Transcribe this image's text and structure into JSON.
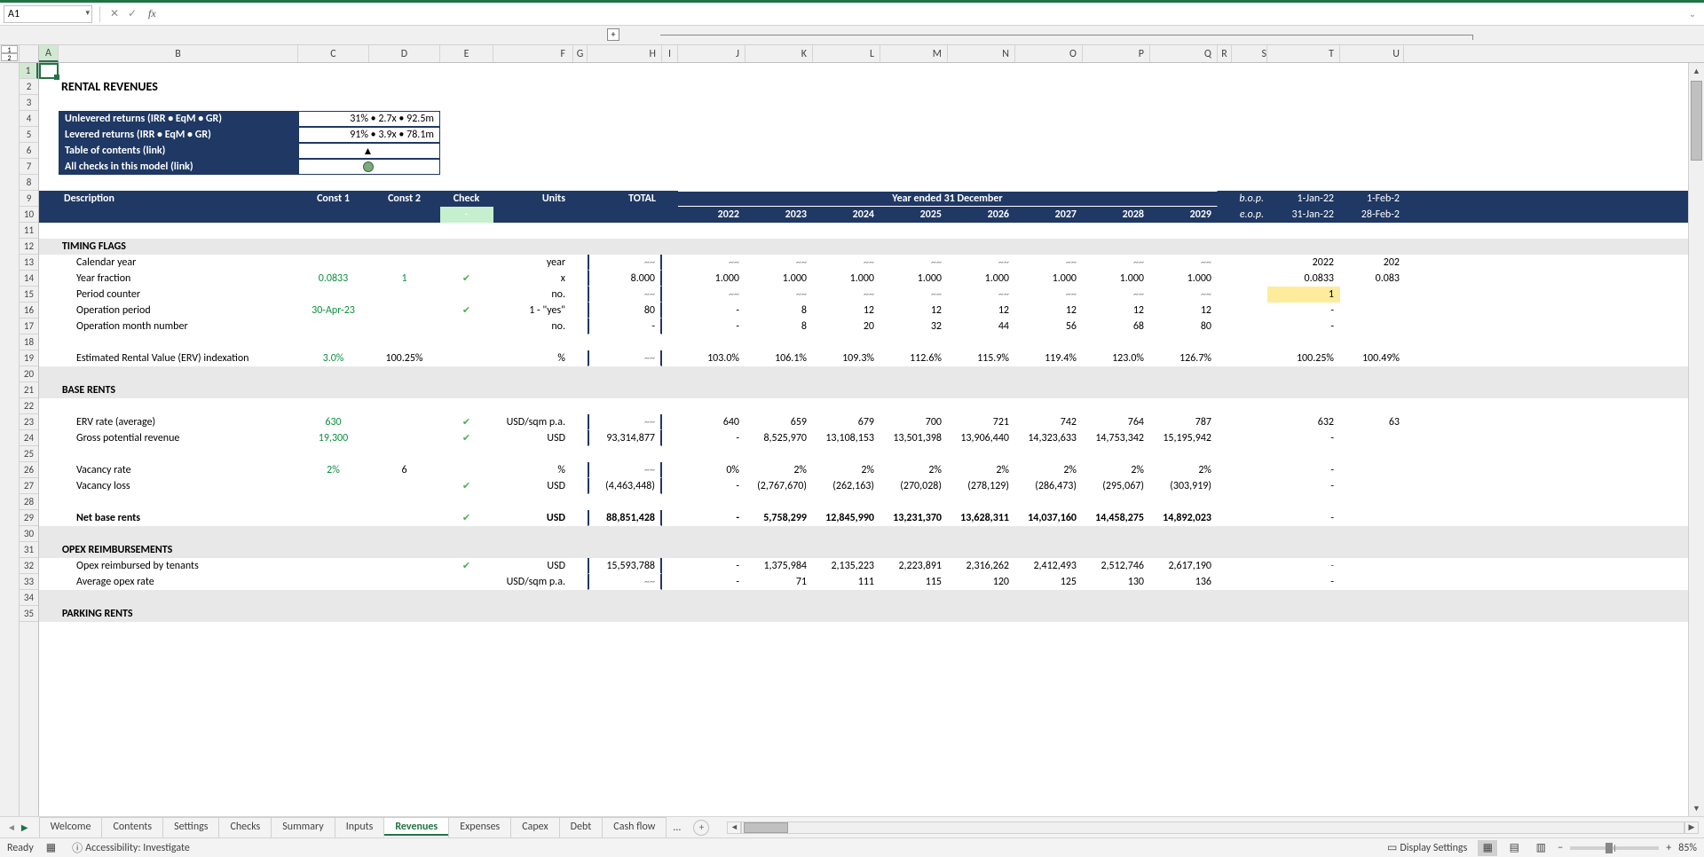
{
  "name_box": "A1",
  "formula_value": "",
  "sheet_title": "RENTAL REVENUES",
  "returns": {
    "unlevered_label": "Unlevered returns (IRR • EqM • GR)",
    "unlevered_value": "31% • 2.7x • 92.5m",
    "levered_label": "Levered returns (IRR • EqM • GR)",
    "levered_value": "91% • 3.9x • 78.1m",
    "toc_label": "Table of contents (link)",
    "checks_label": "All checks in this model (link)"
  },
  "header": {
    "desc": "Description",
    "c1": "Const 1",
    "c2": "Const 2",
    "check": "Check",
    "units": "Units",
    "total": "TOTAL",
    "year_group": "Year ended 31 December",
    "check_val": "-",
    "bop": "b.o.p.",
    "eop": "e.o.p.",
    "bop_t": "1-Jan-22",
    "eop_t": "31-Jan-22",
    "bop_u": "1-Feb-2",
    "eop_u": "28-Feb-2"
  },
  "years": [
    "2022",
    "2023",
    "2024",
    "2025",
    "2026",
    "2027",
    "2028",
    "2029"
  ],
  "sections": {
    "timing": "TIMING FLAGS",
    "base": "BASE RENTS",
    "opex": "OPEX REIMBURSEMENTS",
    "parking": "PARKING RENTS"
  },
  "rows": {
    "cal_year": {
      "desc": "Calendar year",
      "units": "year",
      "total": "~~",
      "y": [
        "~~",
        "~~",
        "~~",
        "~~",
        "~~",
        "~~",
        "~~",
        "~~"
      ],
      "t": "2022",
      "u": "202"
    },
    "year_frac": {
      "desc": "Year fraction",
      "c1": "0.0833",
      "c2": "1",
      "chk": true,
      "units": "x",
      "total": "8.000",
      "y": [
        "1.000",
        "1.000",
        "1.000",
        "1.000",
        "1.000",
        "1.000",
        "1.000",
        "1.000"
      ],
      "t": "0.0833",
      "u": "0.083"
    },
    "period_cnt": {
      "desc": "Period counter",
      "units": "no.",
      "total": "~~",
      "y": [
        "~~",
        "~~",
        "~~",
        "~~",
        "~~",
        "~~",
        "~~",
        "~~"
      ],
      "t": "1",
      "u": "",
      "t_hl": true
    },
    "op_period": {
      "desc": "Operation period",
      "c1": "30-Apr-23",
      "chk": true,
      "units": "1 - \"yes\"",
      "total": "80",
      "y": [
        "-",
        "8",
        "12",
        "12",
        "12",
        "12",
        "12",
        "12"
      ],
      "t": "-",
      "u": ""
    },
    "op_month": {
      "desc": "Operation month number",
      "units": "no.",
      "total": "-",
      "y": [
        "-",
        "8",
        "20",
        "32",
        "44",
        "56",
        "68",
        "80"
      ],
      "t": "-",
      "u": ""
    },
    "erv_idx": {
      "desc": "Estimated Rental Value (ERV) indexation",
      "c1": "3.0%",
      "c2": "100.25%",
      "units": "%",
      "total": "~~",
      "y": [
        "103.0%",
        "106.1%",
        "109.3%",
        "112.6%",
        "115.9%",
        "119.4%",
        "123.0%",
        "126.7%"
      ],
      "t": "100.25%",
      "u": "100.49%"
    },
    "erv_rate": {
      "desc": "ERV rate (average)",
      "c1": "630",
      "chk": true,
      "units": "USD/sqm p.a.",
      "total": "~~",
      "y": [
        "640",
        "659",
        "679",
        "700",
        "721",
        "742",
        "764",
        "787"
      ],
      "t": "632",
      "u": "63"
    },
    "gross_pot": {
      "desc": "Gross potential revenue",
      "c1": "19,300",
      "chk": true,
      "units": "USD",
      "total": "93,314,877",
      "y": [
        "-",
        "8,525,970",
        "13,108,153",
        "13,501,398",
        "13,906,440",
        "14,323,633",
        "14,753,342",
        "15,195,942"
      ],
      "t": "-",
      "u": ""
    },
    "vac_rate": {
      "desc": "Vacancy rate",
      "c1": "2%",
      "c2": "6",
      "units": "%",
      "total": "~~",
      "y": [
        "0%",
        "2%",
        "2%",
        "2%",
        "2%",
        "2%",
        "2%",
        "2%"
      ],
      "t": "-",
      "u": ""
    },
    "vac_loss": {
      "desc": "Vacancy loss",
      "chk": true,
      "units": "USD",
      "total": "(4,463,448)",
      "y": [
        "-",
        "(2,767,670)",
        "(262,163)",
        "(270,028)",
        "(278,129)",
        "(286,473)",
        "(295,067)",
        "(303,919)"
      ],
      "t": "-",
      "u": ""
    },
    "net_base": {
      "desc": "Net base rents",
      "chk": true,
      "units": "USD",
      "total": "88,851,428",
      "y": [
        "-",
        "5,758,299",
        "12,845,990",
        "13,231,370",
        "13,628,311",
        "14,037,160",
        "14,458,275",
        "14,892,023"
      ],
      "t": "-",
      "u": "",
      "bold": true
    },
    "opex_reimb": {
      "desc": "Opex reimbursed by tenants",
      "chk": true,
      "units": "USD",
      "total": "15,593,788",
      "y": [
        "-",
        "1,375,984",
        "2,135,223",
        "2,223,891",
        "2,316,262",
        "2,412,493",
        "2,512,746",
        "2,617,190"
      ],
      "t": "-",
      "u": "",
      "t_green": true
    },
    "avg_opex": {
      "desc": "Average opex rate",
      "units": "USD/sqm p.a.",
      "total": "~~",
      "y": [
        "-",
        "71",
        "111",
        "115",
        "120",
        "125",
        "130",
        "136"
      ],
      "t": "-",
      "u": ""
    }
  },
  "tabs": [
    "Welcome",
    "Contents",
    "Settings",
    "Checks",
    "Summary",
    "Inputs",
    "Revenues",
    "Expenses",
    "Capex",
    "Debt",
    "Cash flow"
  ],
  "tabs_more": "...",
  "active_tab": "Revenues",
  "status": {
    "ready": "Ready",
    "access": "Accessibility: Investigate",
    "display": "Display Settings",
    "zoom": "85%"
  },
  "col_letters": [
    "A",
    "B",
    "C",
    "D",
    "E",
    "F",
    "G",
    "H",
    "I",
    "J",
    "K",
    "L",
    "M",
    "N",
    "O",
    "P",
    "Q",
    "R",
    "S",
    "T",
    "U"
  ]
}
